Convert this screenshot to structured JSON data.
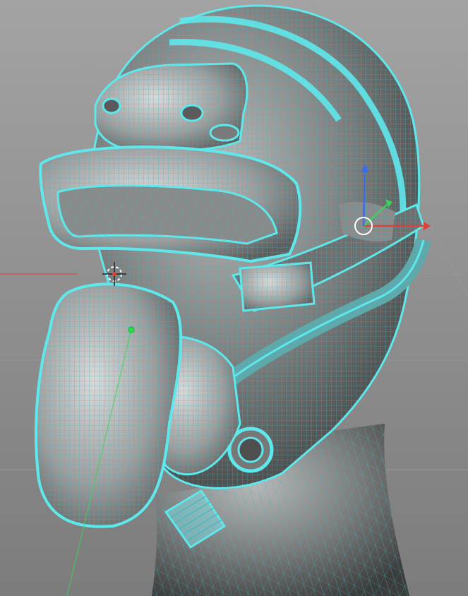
{
  "viewport": {
    "background_top": "#a3a3a3",
    "background_bottom": "#7c7c7c",
    "grid_line_color": "#9a9a9a",
    "wire_color": "#5fe8ec",
    "wire_color_dim": "#3fb8bf",
    "shade_dark": "#3a3a3a",
    "shade_light": "#d8d8d8",
    "axis_x_color": "#e0403a",
    "axis_y_color": "#3fd25a",
    "axis_z_color": "#3f6be8",
    "cursor_color": "#ffffff",
    "origin_dot_color": "#2fdc4a"
  }
}
